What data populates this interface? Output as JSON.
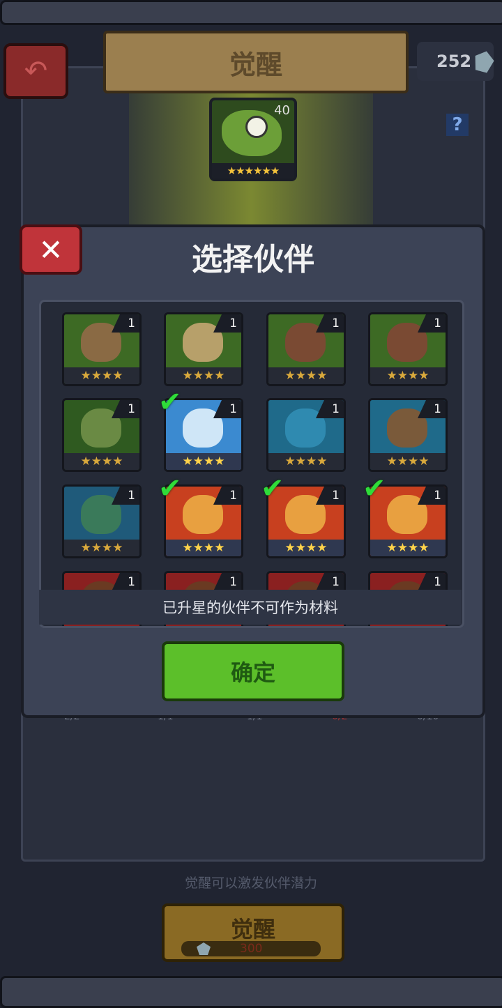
{
  "header": {
    "title": "觉醒",
    "currency_value": "252"
  },
  "help_label": "?",
  "target_hero": {
    "level": "40",
    "stars": "★★★★★★"
  },
  "dialog": {
    "title": "选择伙伴",
    "close_label": "✕",
    "hint": "已升星的伙伴不可作为材料",
    "confirm_label": "确定",
    "partners": [
      {
        "level": "1",
        "stars": "★★★★",
        "color": "#3d6a24",
        "skin": "#8a6a44",
        "selected": false
      },
      {
        "level": "1",
        "stars": "★★★★",
        "color": "#3d6a24",
        "skin": "#b7a06a",
        "selected": false
      },
      {
        "level": "1",
        "stars": "★★★★",
        "color": "#3d6a24",
        "skin": "#7a4a33",
        "selected": false
      },
      {
        "level": "1",
        "stars": "★★★★",
        "color": "#3d6a24",
        "skin": "#7a4a33",
        "selected": false
      },
      {
        "level": "1",
        "stars": "★★★★",
        "color": "#2f5a20",
        "skin": "#6a8a44",
        "selected": false
      },
      {
        "level": "1",
        "stars": "★★★★",
        "color": "#3b8ad0",
        "skin": "#cfe6f7",
        "selected": true
      },
      {
        "level": "1",
        "stars": "★★★★",
        "color": "#1f6a8a",
        "skin": "#2f8ab0",
        "selected": false
      },
      {
        "level": "1",
        "stars": "★★★★",
        "color": "#1f6a8a",
        "skin": "#7a5a3a",
        "selected": false
      },
      {
        "level": "1",
        "stars": "★★★★",
        "color": "#1f5a7a",
        "skin": "#3a7a5a",
        "selected": false
      },
      {
        "level": "1",
        "stars": "★★★★",
        "color": "#c8401f",
        "skin": "#e8a040",
        "selected": true
      },
      {
        "level": "1",
        "stars": "★★★★",
        "color": "#c8401f",
        "skin": "#e8a040",
        "selected": true
      },
      {
        "level": "1",
        "stars": "★★★★",
        "color": "#c8401f",
        "skin": "#e8a040",
        "selected": true
      },
      {
        "level": "1",
        "stars": "",
        "color": "#8a2020",
        "skin": "#6a3a22",
        "selected": false
      },
      {
        "level": "1",
        "stars": "",
        "color": "#8a2020",
        "skin": "#6a3a22",
        "selected": false
      },
      {
        "level": "1",
        "stars": "",
        "color": "#8a2020",
        "skin": "#6a3a22",
        "selected": false
      },
      {
        "level": "1",
        "stars": "",
        "color": "#8a2020",
        "skin": "#6a3a22",
        "selected": false
      }
    ]
  },
  "stats": [
    "2/2",
    "1/1",
    "1/1",
    "0/2",
    "0/10"
  ],
  "footer": {
    "hint": "觉醒可以激发伙伴潜力",
    "awaken_label": "觉醒",
    "cost": "300"
  }
}
